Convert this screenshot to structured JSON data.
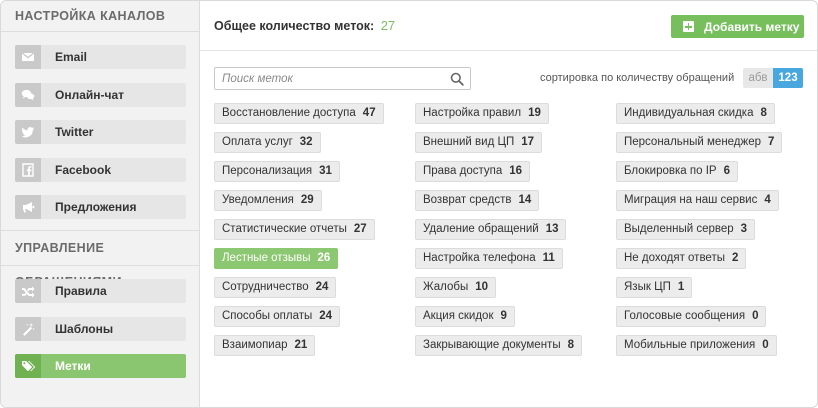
{
  "sidebar": {
    "section1_title": "НАСТРОЙКА КАНАЛОВ",
    "channels": [
      {
        "label": "Email",
        "icon": "envelope-icon"
      },
      {
        "label": "Онлайн-чат",
        "icon": "chat-bubbles-icon"
      },
      {
        "label": "Twitter",
        "icon": "twitter-icon"
      },
      {
        "label": "Facebook",
        "icon": "facebook-icon"
      },
      {
        "label": "Предложения",
        "icon": "megaphone-icon"
      }
    ],
    "section2_title": "УПРАВЛЕНИЕ ОБРАЩЕНИЯМИ",
    "management": [
      {
        "label": "Правила",
        "icon": "shuffle-icon"
      },
      {
        "label": "Шаблоны",
        "icon": "magic-wand-icon"
      },
      {
        "label": "Метки",
        "icon": "tags-icon",
        "active": true
      }
    ]
  },
  "header": {
    "total_label": "Общее количество меток:",
    "total_count": "27",
    "add_button": "Добавить метку"
  },
  "search": {
    "placeholder": "Поиск меток",
    "value": ""
  },
  "sort": {
    "label": "сортировка по количеству обращений",
    "alpha": "абв",
    "numeric": "123",
    "selected": "123"
  },
  "colors": {
    "accent_green": "#76bf5c",
    "sort_blue": "#49a7df"
  },
  "tags": [
    [
      {
        "name": "Восстановление доступа",
        "count": "47"
      },
      {
        "name": "Оплата услуг",
        "count": "32"
      },
      {
        "name": "Персонализация",
        "count": "31"
      },
      {
        "name": "Уведомления",
        "count": "29"
      },
      {
        "name": "Статистические отчеты",
        "count": "27"
      },
      {
        "name": "Лестные отзывы",
        "count": "26",
        "active": true
      },
      {
        "name": "Сотрудничество",
        "count": "24"
      },
      {
        "name": "Способы оплаты",
        "count": "24"
      },
      {
        "name": "Взаимопиар",
        "count": "21"
      }
    ],
    [
      {
        "name": "Настройка правил",
        "count": "19"
      },
      {
        "name": "Внешний вид ЦП",
        "count": "17"
      },
      {
        "name": "Права доступа",
        "count": "16"
      },
      {
        "name": "Возврат средств",
        "count": "14"
      },
      {
        "name": "Удаление обращений",
        "count": "13"
      },
      {
        "name": "Настройка телефона",
        "count": "11"
      },
      {
        "name": "Жалобы",
        "count": "10"
      },
      {
        "name": "Акция скидок",
        "count": "9"
      },
      {
        "name": "Закрывающие документы",
        "count": "8"
      }
    ],
    [
      {
        "name": "Индивидуальная скидка",
        "count": "8"
      },
      {
        "name": "Персональный менеджер",
        "count": "7"
      },
      {
        "name": "Блокировка по IP",
        "count": "6"
      },
      {
        "name": "Миграция на наш сервис",
        "count": "4"
      },
      {
        "name": "Выделенный сервер",
        "count": "3"
      },
      {
        "name": "Не доходят ответы",
        "count": "2"
      },
      {
        "name": "Язык ЦП",
        "count": "1"
      },
      {
        "name": "Голосовые сообщения",
        "count": "0"
      },
      {
        "name": "Мобильные приложения",
        "count": "0"
      }
    ]
  ]
}
